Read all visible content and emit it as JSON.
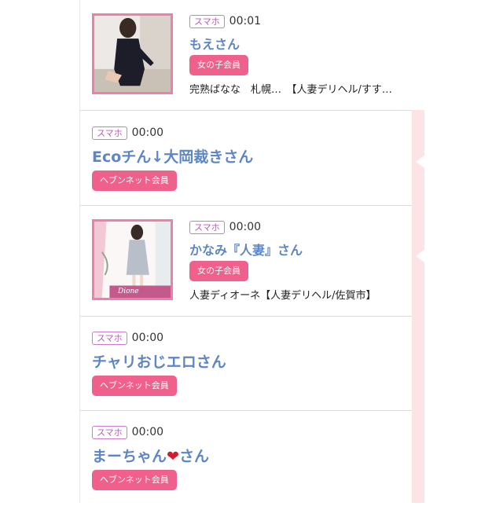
{
  "feed": {
    "items": [
      {
        "device": "スマホ",
        "time": "00:01",
        "name": "もえさん",
        "badge": "女の子会員",
        "shop": "完熟ばなな　札幌…　【人妻デリヘル/すす…"
      },
      {
        "device": "スマホ",
        "time": "00:00",
        "name": "Ecoチん↓大岡裁きさん",
        "badge": "ヘブンネット会員"
      },
      {
        "device": "スマホ",
        "time": "00:00",
        "name": "かなみ『人妻』さん",
        "badge": "女の子会員",
        "shop": "人妻ディオーネ【人妻デリヘル/佐賀市】",
        "photo_text": "Dione"
      },
      {
        "device": "スマホ",
        "time": "00:00",
        "name": "チャリおじエロさん",
        "badge": "ヘブンネット会員"
      },
      {
        "device": "スマホ",
        "time": "00:00",
        "name_prefix": "まーちゃん",
        "name_heart": "❤",
        "name_suffix": "さん",
        "badge": "ヘブンネット会員"
      }
    ]
  },
  "colors": {
    "accent_pink": "#f0608d",
    "name_blue": "#5e86c4",
    "tag_purple": "#cc79c7",
    "heart_red": "#d51b2d"
  },
  "icons": {
    "heart": "heart-icon"
  }
}
